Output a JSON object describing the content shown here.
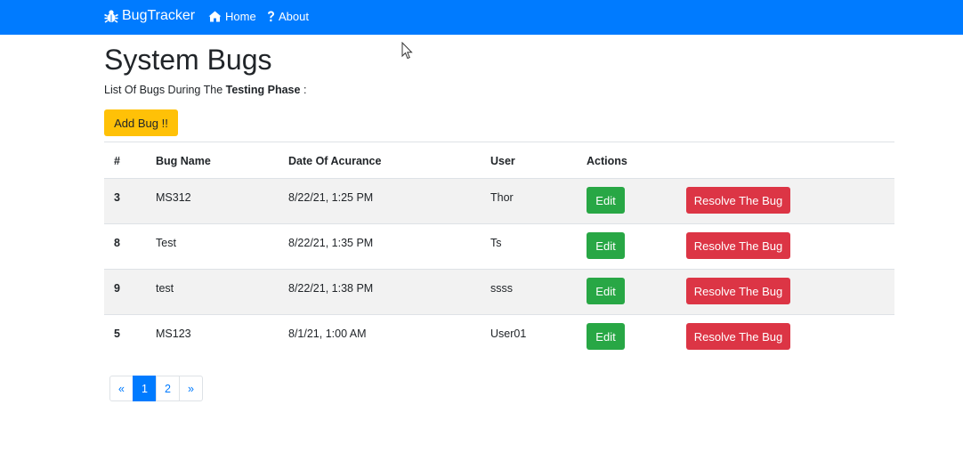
{
  "navbar": {
    "brand": "BugTracker",
    "brand_icon": "bug-icon",
    "links": [
      {
        "label": "Home",
        "icon": "home-icon"
      },
      {
        "label": "About",
        "icon": "question-icon"
      }
    ]
  },
  "main": {
    "title": "System Bugs",
    "subtitle_prefix": "List Of Bugs During The ",
    "subtitle_bold": "Testing Phase",
    "subtitle_suffix": " :",
    "add_button": "Add Bug !!"
  },
  "table": {
    "columns": [
      "#",
      "Bug Name",
      "Date Of Acurance",
      "User",
      "Actions"
    ],
    "rows": [
      {
        "id": "3",
        "name": "MS312",
        "date": "8/22/21, 1:25 PM",
        "user": "Thor",
        "edit": "Edit",
        "resolve": "Resolve The Bug"
      },
      {
        "id": "8",
        "name": "Test",
        "date": "8/22/21, 1:35 PM",
        "user": "Ts",
        "edit": "Edit",
        "resolve": "Resolve The Bug"
      },
      {
        "id": "9",
        "name": "test",
        "date": "8/22/21, 1:38 PM",
        "user": "ssss",
        "edit": "Edit",
        "resolve": "Resolve The Bug"
      },
      {
        "id": "5",
        "name": "MS123",
        "date": "8/1/21, 1:00 AM",
        "user": "User01",
        "edit": "Edit",
        "resolve": "Resolve The Bug"
      }
    ]
  },
  "pagination": {
    "prev": "«",
    "pages": [
      "1",
      "2"
    ],
    "active_page": "1",
    "next": "»"
  },
  "colors": {
    "primary": "#007bff",
    "warning": "#ffc107",
    "success": "#28a745",
    "danger": "#dc3545"
  }
}
